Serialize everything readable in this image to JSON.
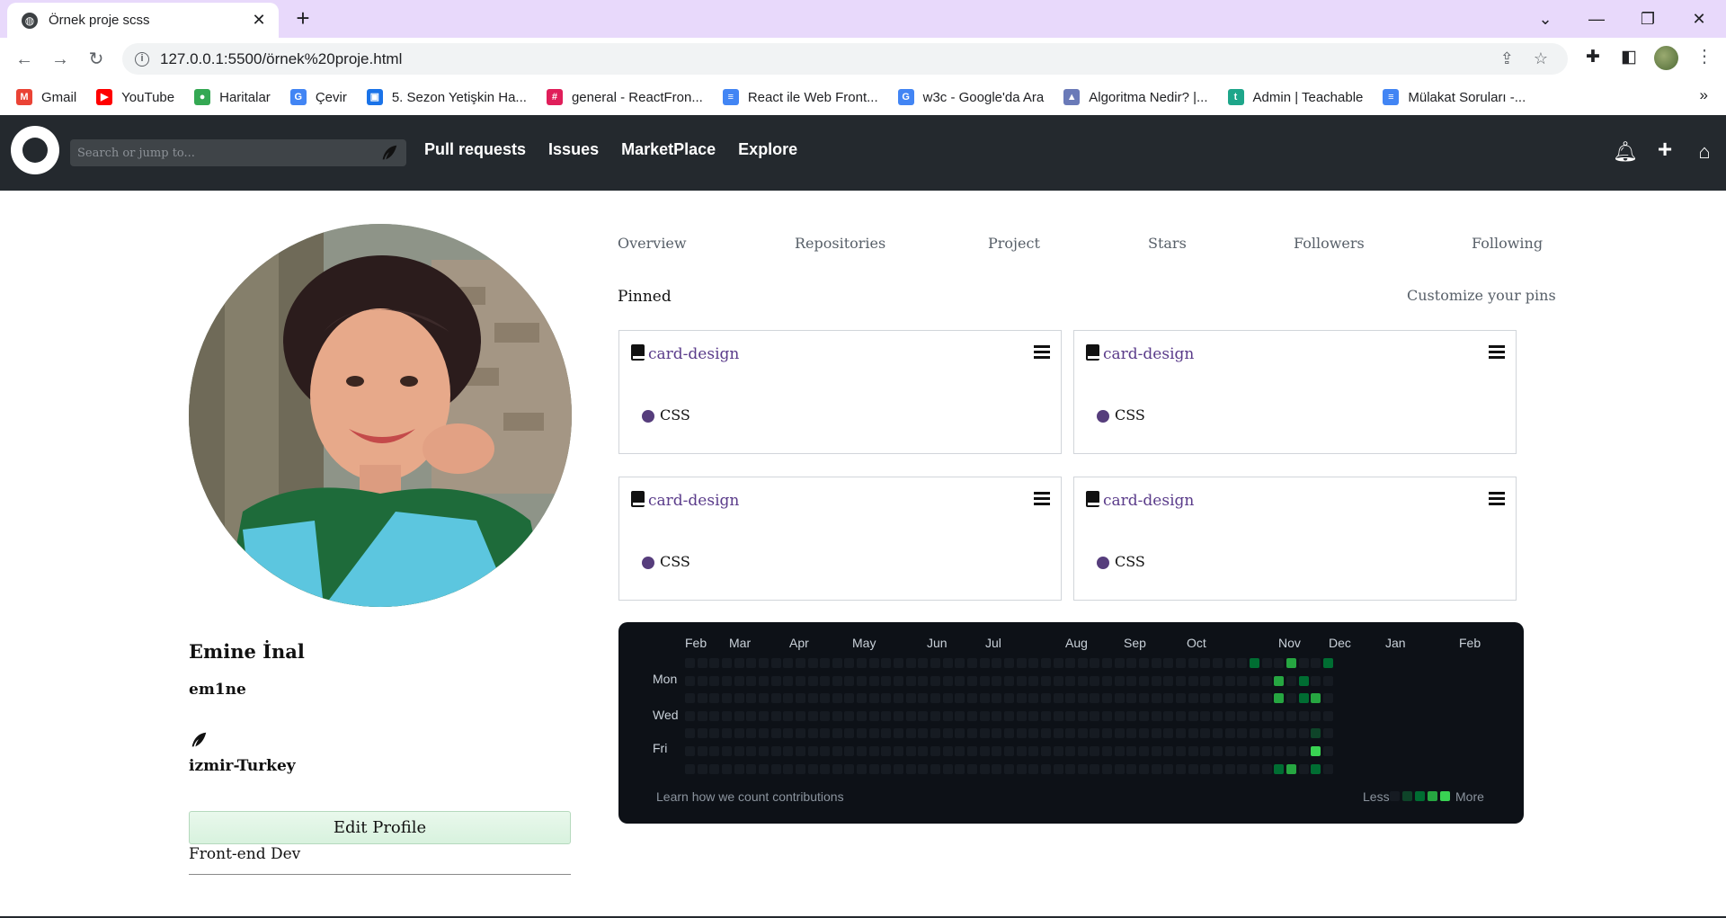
{
  "browser": {
    "tab_title": "Örnek proje scss",
    "url": "127.0.0.1:5500/örnek%20proje.html",
    "bookmarks": [
      {
        "label": "Gmail",
        "color": "#ea4335",
        "glyph": "M"
      },
      {
        "label": "YouTube",
        "color": "#ff0000",
        "glyph": "▶"
      },
      {
        "label": "Haritalar",
        "color": "#34a853",
        "glyph": "●"
      },
      {
        "label": "Çevir",
        "color": "#4285f4",
        "glyph": "G"
      },
      {
        "label": "5. Sezon Yetişkin Ha...",
        "color": "#1a73e8",
        "glyph": "▣"
      },
      {
        "label": "general - ReactFron...",
        "color": "#e01e5a",
        "glyph": "#"
      },
      {
        "label": "React ile Web Front...",
        "color": "#4285f4",
        "glyph": "≡"
      },
      {
        "label": "w3c - Google'da Ara",
        "color": "#4285f4",
        "glyph": "G"
      },
      {
        "label": "Algoritma Nedir? |...",
        "color": "#6a7ab8",
        "glyph": "▲"
      },
      {
        "label": "Admin | Teachable",
        "color": "#1ea68a",
        "glyph": "t"
      },
      {
        "label": "Mülakat Soruları -...",
        "color": "#4285f4",
        "glyph": "≡"
      }
    ]
  },
  "header": {
    "search_placeholder": "Search or jump to...",
    "nav": [
      "Pull requests",
      "Issues",
      "MarketPlace",
      "Explore"
    ]
  },
  "profile": {
    "name": "Emine İnal",
    "login": "em1ne",
    "location": "izmir-Turkey",
    "edit_button": "Edit Profile",
    "bio": "Front-end Dev"
  },
  "tabs": [
    "Overview",
    "Repositories",
    "Project",
    "Stars",
    "Followers",
    "Following"
  ],
  "pinned": {
    "title": "Pinned",
    "customize": "Customize your pins",
    "cards": [
      {
        "name": "card-design",
        "language": "CSS"
      },
      {
        "name": "card-design",
        "language": "CSS"
      },
      {
        "name": "card-design",
        "language": "CSS"
      },
      {
        "name": "card-design",
        "language": "CSS"
      }
    ],
    "language_color": "#563d7c"
  },
  "contributions": {
    "months": [
      "Feb",
      "Mar",
      "Apr",
      "May",
      "Jun",
      "Jul",
      "Aug",
      "Sep",
      "Oct",
      "Nov",
      "Dec",
      "Jan",
      "Feb"
    ],
    "day_labels": [
      "Mon",
      "Wed",
      "Fri"
    ],
    "learn_text": "Learn how we count contributions",
    "legend_less": "Less",
    "legend_more": "More",
    "level_colors": [
      "#161b22",
      "#0e4429",
      "#006d32",
      "#26a641",
      "#39d353"
    ],
    "active": [
      {
        "week": 46,
        "day": 0,
        "level": 2
      },
      {
        "week": 49,
        "day": 0,
        "level": 3
      },
      {
        "week": 52,
        "day": 0,
        "level": 2
      },
      {
        "week": 48,
        "day": 1,
        "level": 3
      },
      {
        "week": 50,
        "day": 1,
        "level": 2
      },
      {
        "week": 48,
        "day": 2,
        "level": 3
      },
      {
        "week": 50,
        "day": 2,
        "level": 2
      },
      {
        "week": 51,
        "day": 2,
        "level": 3
      },
      {
        "week": 51,
        "day": 4,
        "level": 1
      },
      {
        "week": 51,
        "day": 5,
        "level": 4
      },
      {
        "week": 48,
        "day": 6,
        "level": 2
      },
      {
        "week": 49,
        "day": 6,
        "level": 3
      },
      {
        "week": 51,
        "day": 6,
        "level": 2
      }
    ]
  }
}
